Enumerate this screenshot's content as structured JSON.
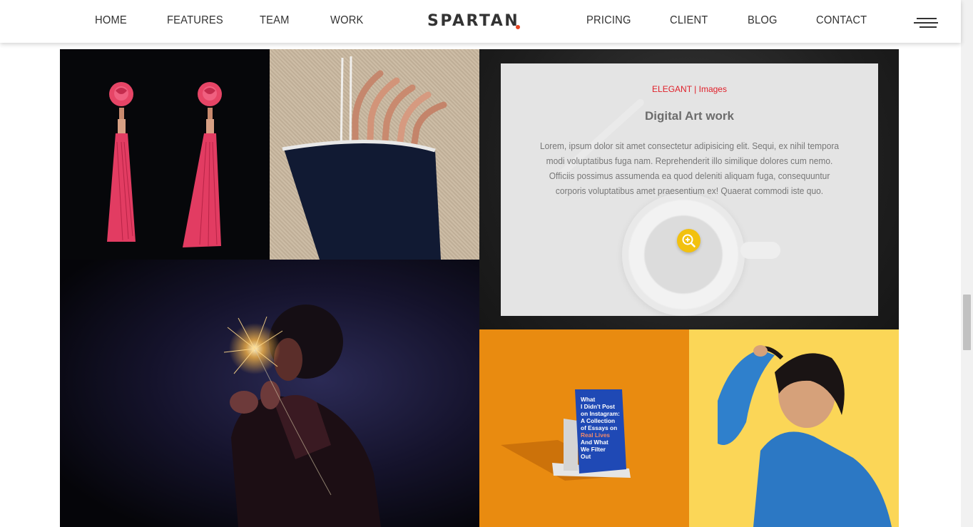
{
  "nav": {
    "left": [
      {
        "label": "HOME"
      },
      {
        "label": "FEATURES"
      },
      {
        "label": "TEAM"
      },
      {
        "label": "WORK"
      }
    ],
    "brand": "SPARTAN",
    "right": [
      {
        "label": "PRICING"
      },
      {
        "label": "CLIENT"
      },
      {
        "label": "BLOG"
      },
      {
        "label": "CONTACT"
      }
    ],
    "menu_icon": "hamburger-menu-icon"
  },
  "gallery": {
    "images": [
      {
        "subject": "pink-tassel-earrings-image"
      },
      {
        "subject": "metal-straws-pouch-image"
      },
      {
        "subject": "sparkler-portrait-image"
      },
      {
        "subject": "book-on-stand-image"
      },
      {
        "subject": "denim-jacket-woman-image"
      }
    ],
    "feature": {
      "category": "ELEGANT | Images",
      "title": "Digital Art work",
      "description": "Lorem, ipsum dolor sit amet consectetur adipisicing elit. Sequi, ex nihil tempora modi voluptatibus fuga nam. Reprehenderit illo similique dolores cum nemo. Officiis possimus assumenda ea quod deleniti aliquam fuga, consequuntur corporis voluptatibus amet praesentium ex! Quaerat commodi iste quo.",
      "zoom_icon": "zoom-in-icon"
    },
    "book_cover": {
      "lines": [
        "What",
        "I Didn't Post",
        "on Instagram:",
        "A Collection",
        "of Essays on",
        "Real Lives",
        "And What",
        "We Filter",
        "Out"
      ]
    }
  },
  "colors": {
    "brand_dot": "#e8431f",
    "category_text": "#e0202a",
    "zoom_button": "#f2c10f",
    "book_background": "#e98b10",
    "denim_background": "#fbd657"
  }
}
